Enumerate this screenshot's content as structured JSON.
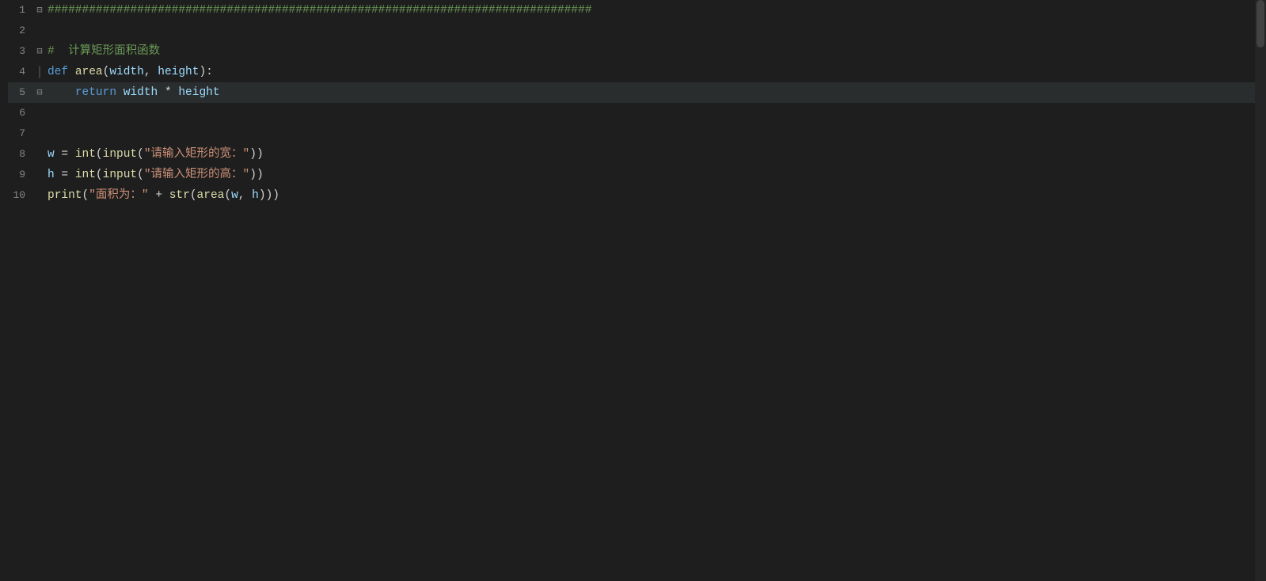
{
  "editor": {
    "background": "#1e1e1e",
    "lines": [
      {
        "number": 1,
        "fold": "top",
        "content": [
          {
            "type": "hash",
            "text": "###############################################################################"
          }
        ]
      },
      {
        "number": 2,
        "fold": null,
        "content": []
      },
      {
        "number": 3,
        "fold": "top",
        "content": [
          {
            "type": "hash",
            "text": "#  "
          },
          {
            "type": "comment",
            "text": "计算矩形面积函数"
          }
        ]
      },
      {
        "number": 4,
        "fold": "mid",
        "content": [
          {
            "type": "keyword",
            "text": "def"
          },
          {
            "type": "default",
            "text": " "
          },
          {
            "type": "function",
            "text": "area"
          },
          {
            "type": "default",
            "text": "("
          },
          {
            "type": "param",
            "text": "width"
          },
          {
            "type": "default",
            "text": ", "
          },
          {
            "type": "param",
            "text": "height"
          },
          {
            "type": "default",
            "text": "):"
          }
        ]
      },
      {
        "number": 5,
        "fold": "bot",
        "highlighted": true,
        "content": [
          {
            "type": "default",
            "text": "    "
          },
          {
            "type": "keyword",
            "text": "return"
          },
          {
            "type": "default",
            "text": " "
          },
          {
            "type": "param",
            "text": "width"
          },
          {
            "type": "default",
            "text": " * "
          },
          {
            "type": "param",
            "text": "height"
          }
        ]
      },
      {
        "number": 6,
        "fold": null,
        "content": []
      },
      {
        "number": 7,
        "fold": null,
        "content": []
      },
      {
        "number": 8,
        "fold": null,
        "content": [
          {
            "type": "var",
            "text": "w"
          },
          {
            "type": "default",
            "text": " = "
          },
          {
            "type": "builtin",
            "text": "int"
          },
          {
            "type": "default",
            "text": "("
          },
          {
            "type": "builtin",
            "text": "input"
          },
          {
            "type": "default",
            "text": "("
          },
          {
            "type": "string",
            "text": "\"请输入矩形的宽：\""
          },
          {
            "type": "default",
            "text": "))"
          }
        ]
      },
      {
        "number": 9,
        "fold": null,
        "content": [
          {
            "type": "var",
            "text": "h"
          },
          {
            "type": "default",
            "text": " = "
          },
          {
            "type": "builtin",
            "text": "int"
          },
          {
            "type": "default",
            "text": "("
          },
          {
            "type": "builtin",
            "text": "input"
          },
          {
            "type": "default",
            "text": "("
          },
          {
            "type": "string",
            "text": "\"请输入矩形的高：\""
          },
          {
            "type": "default",
            "text": "))"
          }
        ]
      },
      {
        "number": 10,
        "fold": null,
        "content": [
          {
            "type": "builtin",
            "text": "print"
          },
          {
            "type": "default",
            "text": "("
          },
          {
            "type": "string",
            "text": "\"面积为：\""
          },
          {
            "type": "default",
            "text": " + "
          },
          {
            "type": "builtin",
            "text": "str"
          },
          {
            "type": "default",
            "text": "("
          },
          {
            "type": "function",
            "text": "area"
          },
          {
            "type": "default",
            "text": "("
          },
          {
            "type": "var",
            "text": "w"
          },
          {
            "type": "default",
            "text": ", "
          },
          {
            "type": "var",
            "text": "h"
          },
          {
            "type": "default",
            "text": ")))"
          }
        ]
      }
    ]
  }
}
